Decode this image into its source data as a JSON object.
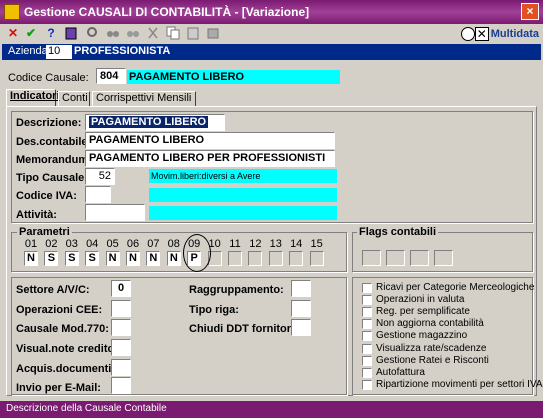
{
  "window": {
    "title": "Gestione CAUSALI DI CONTABILITÀ - [Variazione]",
    "close": "×"
  },
  "toolbar": {
    "cancel": "✕",
    "confirm": "✔",
    "help": "?",
    "brand": "Multidata"
  },
  "azienda": {
    "label": "Azienda:",
    "code": "10",
    "name": "PROFESSIONISTA"
  },
  "codice": {
    "label": "Codice Causale:",
    "value": "804",
    "desc": "PAGAMENTO LIBERO"
  },
  "tabs": [
    {
      "label": "Indicatori"
    },
    {
      "label": "Conti"
    },
    {
      "label": "Corrispettivi Mensili"
    }
  ],
  "fields": {
    "descrizione": {
      "label": "Descrizione:",
      "value": "PAGAMENTO LIBERO"
    },
    "descontabile": {
      "label": "Des.contabile:",
      "value": "PAGAMENTO LIBERO"
    },
    "memorandum": {
      "label": "Memorandum:",
      "value": "PAGAMENTO LIBERO PER PROFESSIONISTI"
    },
    "tipo": {
      "label": "Tipo Causale:",
      "value": "52",
      "desc": "Movim.liberi:diversi a Avere"
    },
    "iva": {
      "label": "Codice IVA:",
      "value": ""
    },
    "attivita": {
      "label": "Attività:",
      "value": ""
    }
  },
  "parametri": {
    "title": "Parametri",
    "numbers": [
      "01",
      "02",
      "03",
      "04",
      "05",
      "06",
      "07",
      "08",
      "09",
      "10",
      "11",
      "12",
      "13",
      "14",
      "15"
    ],
    "values": [
      "N",
      "S",
      "S",
      "S",
      "N",
      "N",
      "N",
      "N",
      "P",
      "",
      "",
      "",
      "",
      "",
      ""
    ]
  },
  "flags": {
    "title": "Flags contabili"
  },
  "settori": {
    "avc": {
      "label": "Settore A/V/C:",
      "value": "0"
    },
    "cee": {
      "label": "Operazioni CEE:",
      "value": ""
    },
    "mod770": {
      "label": "Causale Mod.770:",
      "value": ""
    },
    "visual": {
      "label": "Visual.note credito:",
      "value": ""
    },
    "acquis": {
      "label": "Acquis.documenti:",
      "value": ""
    },
    "email": {
      "label": "Invio per E-Mail:",
      "value": ""
    },
    "raggr": {
      "label": "Raggruppamento:",
      "value": ""
    },
    "tiporiga": {
      "label": "Tipo riga:",
      "value": ""
    },
    "ddt": {
      "label": "Chiudi DDT fornitori:",
      "value": ""
    }
  },
  "checks": [
    "Ricavi per Categorie Merceologiche",
    "Operazioni in valuta",
    "Reg. per semplificate",
    "Non aggiorna contabilità",
    "Gestione magazzino",
    "Visualizza rate/scadenze",
    "Gestione Ratei e Risconti",
    "Autofattura",
    "Ripartizione movimenti per settori IVA"
  ],
  "status": "Descrizione della Causale Contabile"
}
